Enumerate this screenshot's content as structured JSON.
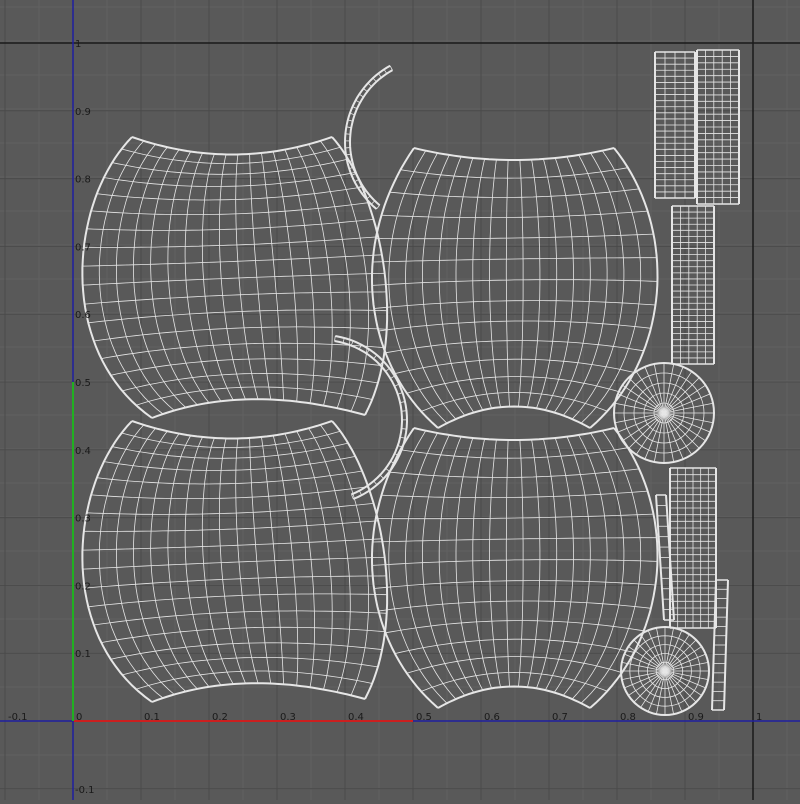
{
  "colors": {
    "background": "#595959",
    "grid_minor": "#616161",
    "grid_major": "#4a4a4a",
    "frame": "#1a1a1a",
    "u_axis": "#cc1f1f",
    "v_axis": "#20b020",
    "axis_dark": "#1f1fa0",
    "wire": "#e6e6e6",
    "label": "#1a1a1a"
  },
  "axes": {
    "u_ticks": [
      "-0.1",
      "0",
      "0.1",
      "0.2",
      "0.3",
      "0.4",
      "0.5",
      "0.6",
      "0.7",
      "0.8",
      "0.9",
      "1"
    ],
    "v_ticks": [
      "1",
      "0.9",
      "0.8",
      "0.7",
      "0.6",
      "0.5",
      "0.4",
      "0.3",
      "0.2",
      "0.1",
      "-0.1"
    ]
  },
  "uv_islands": [
    {
      "name": "upper-left-shell",
      "icon": "curved-grid"
    },
    {
      "name": "upper-right-shell",
      "icon": "curved-grid"
    },
    {
      "name": "lower-left-shell",
      "icon": "curved-grid"
    },
    {
      "name": "lower-right-shell",
      "icon": "curved-grid"
    },
    {
      "name": "upper-arc-strip",
      "icon": "arc"
    },
    {
      "name": "lower-arc-strip",
      "icon": "arc"
    },
    {
      "name": "upper-cap-disk",
      "icon": "radial-disk"
    },
    {
      "name": "lower-cap-disk",
      "icon": "radial-disk"
    },
    {
      "name": "rim-strip-tall",
      "icon": "grid-strip"
    },
    {
      "name": "rim-strip-short",
      "icon": "grid-strip"
    }
  ]
}
